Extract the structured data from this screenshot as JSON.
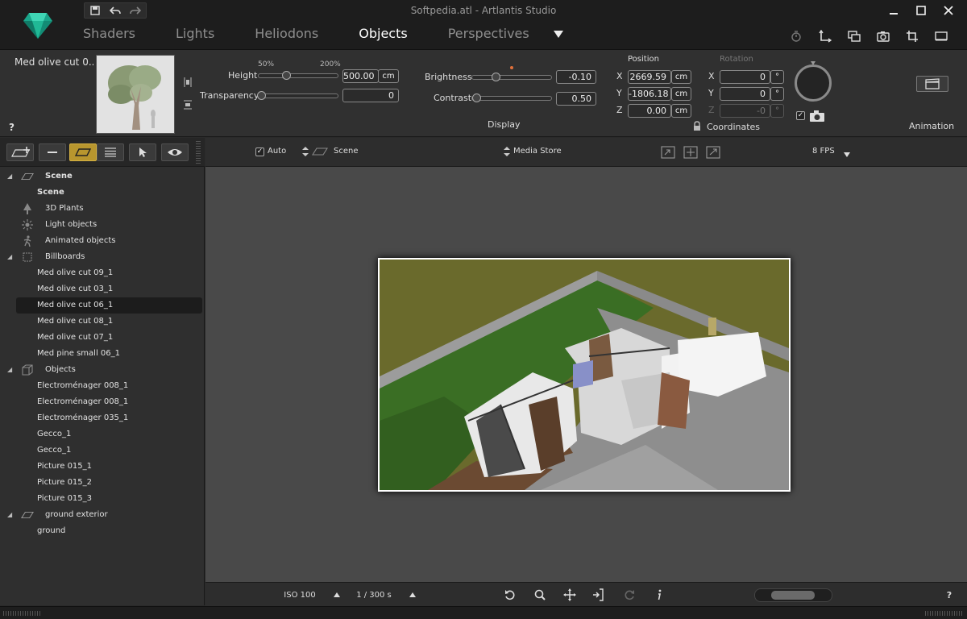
{
  "window": {
    "title": "Softpedia.atl - Artlantis Studio"
  },
  "tabs": [
    {
      "label": "Shaders"
    },
    {
      "label": "Lights"
    },
    {
      "label": "Heliodons"
    },
    {
      "label": "Objects"
    },
    {
      "label": "Perspectives"
    }
  ],
  "active_tab": "Objects",
  "inspector": {
    "object_name": "Med olive cut 0...",
    "help": "?",
    "height_label": "Height",
    "scale_min": "50%",
    "scale_max": "200%",
    "height_value": "500.00",
    "height_unit": "cm",
    "transparency_label": "Transparency",
    "transparency_value": "0",
    "brightness_label": "Brightness",
    "brightness_value": "-0.10",
    "contrast_label": "Contrast",
    "contrast_value": "0.50",
    "display_label": "Display",
    "position_label": "Position",
    "rotation_label": "Rotation",
    "pos_x_label": "X",
    "pos_y_label": "Y",
    "pos_z_label": "Z",
    "pos_x": "2669.59",
    "pos_y": "-1806.18",
    "pos_z": "0.00",
    "pos_unit": "cm",
    "rot_x_label": "X",
    "rot_y_label": "Y",
    "rot_z_label": "Z",
    "rot_x": "0",
    "rot_y": "0",
    "rot_z": "-0",
    "deg_unit": "°",
    "coordinates_label": "Coordinates",
    "animation_label": "Animation"
  },
  "tree": [
    {
      "label": "Scene",
      "bold": true,
      "indent": 1,
      "twisty": true,
      "icon": "plane-icon"
    },
    {
      "label": "Scene",
      "bold": true,
      "indent": 0
    },
    {
      "label": "3D Plants",
      "indent": 1,
      "icon": "tree-icon"
    },
    {
      "label": "Light objects",
      "indent": 1,
      "icon": "light-icon"
    },
    {
      "label": "Animated objects",
      "indent": 1,
      "icon": "walker-icon"
    },
    {
      "label": "Billboards",
      "indent": 1,
      "twisty": true,
      "icon": "billboard-icon"
    },
    {
      "label": "Med olive cut 09_1",
      "indent": 0
    },
    {
      "label": "Med olive cut 03_1",
      "indent": 0
    },
    {
      "label": "Med olive cut 06_1",
      "indent": 0,
      "selected": true
    },
    {
      "label": "Med olive cut 08_1",
      "indent": 0
    },
    {
      "label": "Med olive cut 07_1",
      "indent": 0
    },
    {
      "label": "Med pine small 06_1",
      "indent": 0
    },
    {
      "label": "Objects",
      "indent": 1,
      "twisty": true,
      "icon": "cube-icon"
    },
    {
      "label": "Electroménager 008_1",
      "indent": 0
    },
    {
      "label": "Electroménager 008_1",
      "indent": 0
    },
    {
      "label": "Electroménager 035_1",
      "indent": 0
    },
    {
      "label": "Gecco_1",
      "indent": 0
    },
    {
      "label": "Gecco_1",
      "indent": 0
    },
    {
      "label": "Picture 015_1",
      "indent": 0
    },
    {
      "label": "Picture 015_2",
      "indent": 0
    },
    {
      "label": "Picture 015_3",
      "indent": 0
    },
    {
      "label": "ground exterior",
      "indent": 1,
      "twisty": true,
      "icon": "plane-icon"
    },
    {
      "label": "ground",
      "indent": 0
    }
  ],
  "viewport_toolbar": {
    "auto_label": "Auto",
    "auto_checked": true,
    "scene_label": "Scene",
    "media_store_label": "Media Store",
    "fps_label": "8 FPS"
  },
  "bottombar": {
    "iso_label": "ISO 100",
    "shutter_label": "1 / 300 s",
    "help": "?"
  },
  "colors": {
    "accent": "#b8962e",
    "panel": "#303030",
    "viewport": "#494949"
  }
}
